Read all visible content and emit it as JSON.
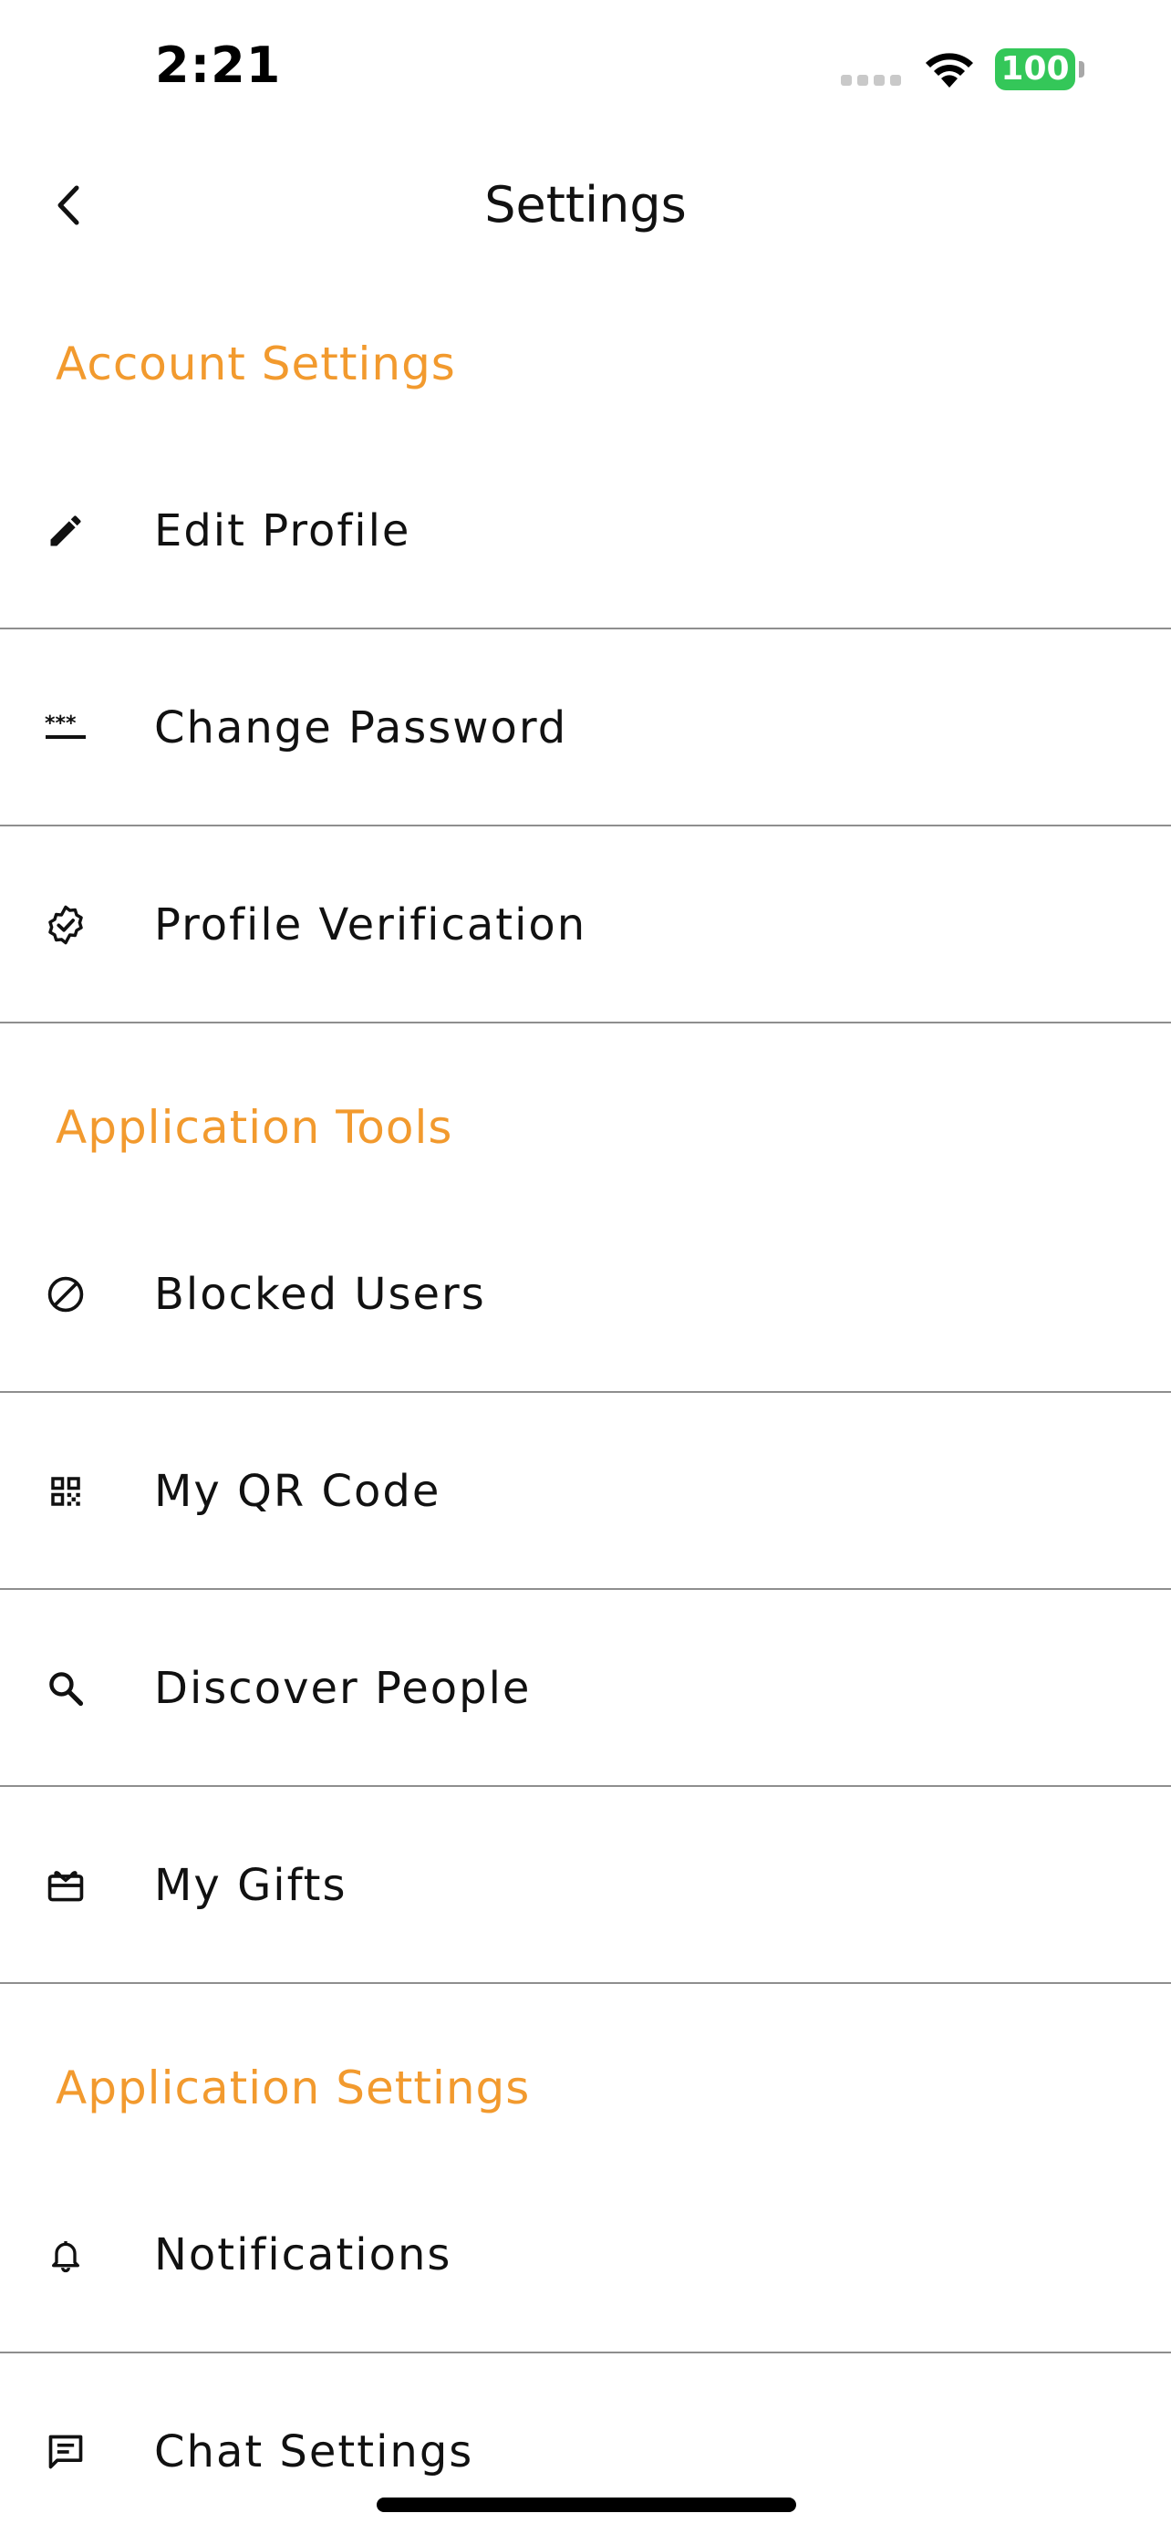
{
  "status_bar": {
    "time": "2:21",
    "battery_level": "100",
    "battery_color": "#34c759"
  },
  "nav": {
    "title": "Settings",
    "back_icon": "chevron-left-icon"
  },
  "colors": {
    "section_header": "#f29a2e",
    "divider": "#8e8e8e"
  },
  "sections": [
    {
      "title": "Account Settings",
      "items": [
        {
          "label": "Edit Profile",
          "icon": "pencil-icon"
        },
        {
          "label": "Change Password",
          "icon": "password-icon"
        },
        {
          "label": "Profile Verification",
          "icon": "verified-badge-icon"
        }
      ]
    },
    {
      "title": "Application Tools",
      "items": [
        {
          "label": "Blocked Users",
          "icon": "block-icon"
        },
        {
          "label": "My QR Code",
          "icon": "qr-code-icon"
        },
        {
          "label": "Discover People",
          "icon": "search-icon"
        },
        {
          "label": "My Gifts",
          "icon": "gift-card-icon"
        }
      ]
    },
    {
      "title": "Application Settings",
      "items": [
        {
          "label": "Notifications",
          "icon": "bell-icon"
        },
        {
          "label": "Chat Settings",
          "icon": "chat-icon"
        }
      ]
    }
  ]
}
